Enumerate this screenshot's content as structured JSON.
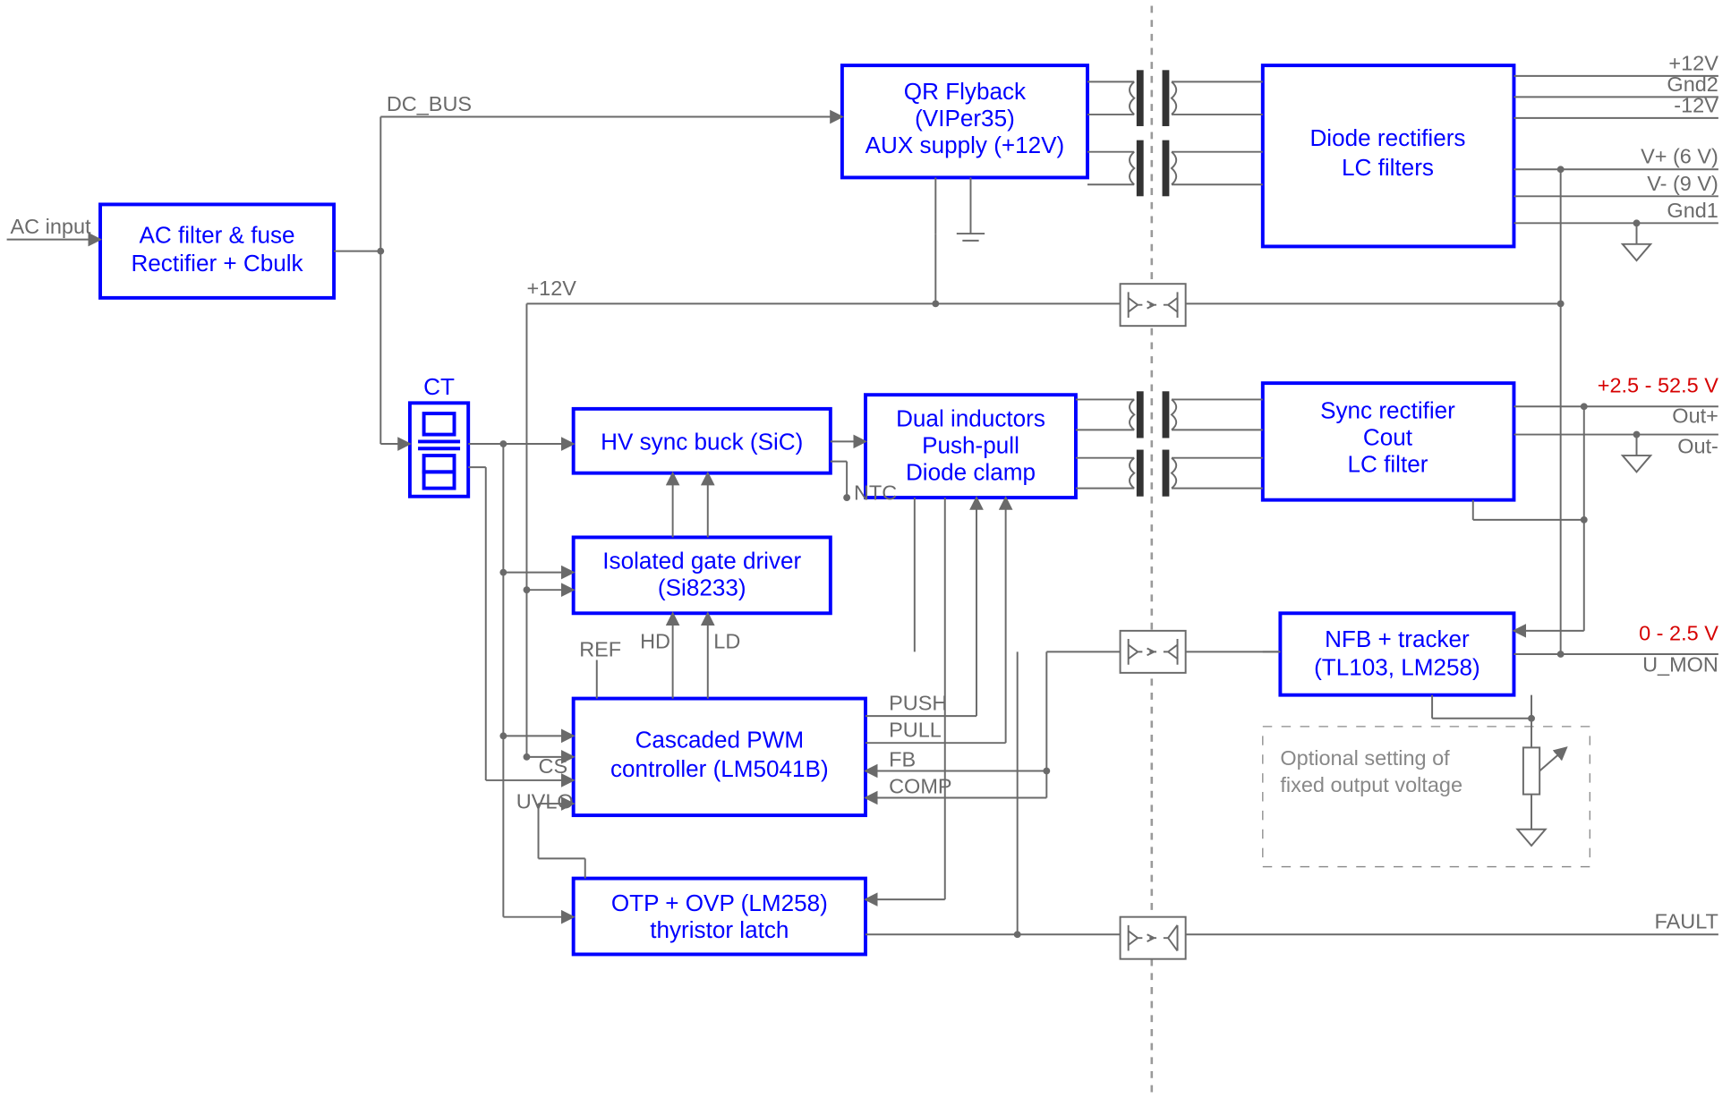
{
  "blocks": {
    "ac_filter": {
      "l1": "AC filter & fuse",
      "l2": "Rectifier + Cbulk"
    },
    "qr": {
      "l1": "QR Flyback",
      "l2": "(VIPer35)",
      "l3": "AUX supply (+12V)"
    },
    "diode": {
      "l1": "Diode rectifiers",
      "l2": "LC filters"
    },
    "ct": "CT",
    "hvsync": "HV sync buck (SiC)",
    "dual": {
      "l1": "Dual inductors",
      "l2": "Push-pull",
      "l3": "Diode clamp"
    },
    "syncrect": {
      "l1": "Sync rectifier",
      "l2": "Cout",
      "l3": "LC filter"
    },
    "igd": {
      "l1": "Isolated gate driver",
      "l2": "(Si8233)"
    },
    "pwm": {
      "l1": "Cascaded PWM",
      "l2": "controller (LM5041B)"
    },
    "otp": {
      "l1": "OTP + OVP (LM258)",
      "l2": "thyristor latch"
    },
    "nfb": {
      "l1": "NFB + tracker",
      "l2": "(TL103, LM258)"
    }
  },
  "signals": {
    "ac_input": "AC input",
    "dc_bus": "DC_BUS",
    "p12v": "+12V",
    "gnd2": "Gnd2",
    "m12v": "-12V",
    "vp": "V+ (6 V)",
    "vm": "V- (9 V)",
    "gnd1": "Gnd1",
    "plus12": "+12V",
    "ntc": "NTC",
    "hd": "HD",
    "ld": "LD",
    "ref": "REF",
    "push": "PUSH",
    "pull": "PULL",
    "fb": "FB",
    "comp": "COMP",
    "cs": "CS",
    "uvlo": "UVLO",
    "outv": "+2.5 - 52.5 V",
    "outp": "Out+",
    "outm": "Out-",
    "umonv": "0 - 2.5 V",
    "umon": "U_MON",
    "fault": "FAULT",
    "opt": {
      "l1": "Optional setting of",
      "l2": "fixed output voltage"
    }
  }
}
